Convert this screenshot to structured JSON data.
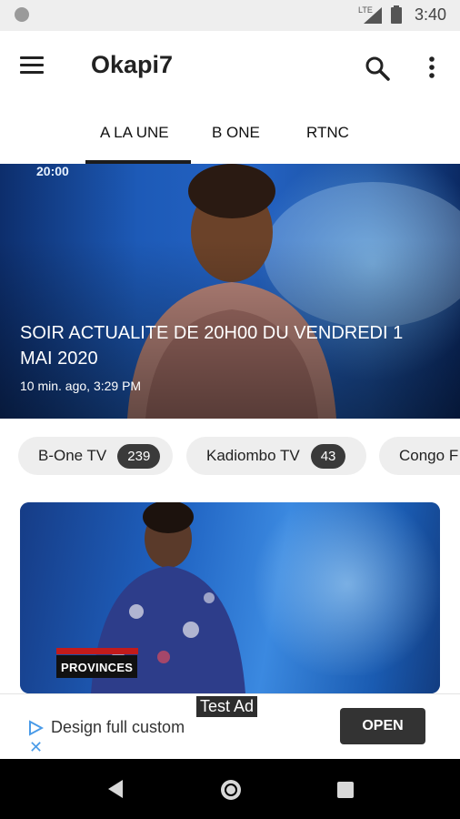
{
  "status_bar": {
    "network": "LTE",
    "time": "3:40"
  },
  "app_bar": {
    "title": "Okapi7"
  },
  "tabs": [
    {
      "label": "A LA UNE",
      "selected": true
    },
    {
      "label": "B ONE",
      "selected": false
    },
    {
      "label": "RTNC",
      "selected": false
    }
  ],
  "hero": {
    "title": "SOIR ACTUALITE DE 20H00 DU VENDREDI 1 MAI 2020",
    "time": "10 min. ago, 3:29 PM",
    "logo": "20:00"
  },
  "channels": [
    {
      "name": "B-One TV",
      "count": "239"
    },
    {
      "name": "Kadiombo TV",
      "count": "43"
    },
    {
      "name": "Congo F",
      "count": ""
    }
  ],
  "card": {
    "badge": "PROVINCES"
  },
  "ad": {
    "label": "Test Ad",
    "text": "Design full custom",
    "button": "OPEN"
  },
  "colors": {
    "accent": "#1c1c1c",
    "chip_bg": "#eeeeee",
    "count_bg": "#3a3a3a",
    "ad_button": "#333333"
  },
  "icons": [
    "menu-icon",
    "search-icon",
    "more-vert-icon",
    "back-icon",
    "home-icon",
    "recents-icon",
    "ad-play-icon",
    "ad-close-icon"
  ]
}
